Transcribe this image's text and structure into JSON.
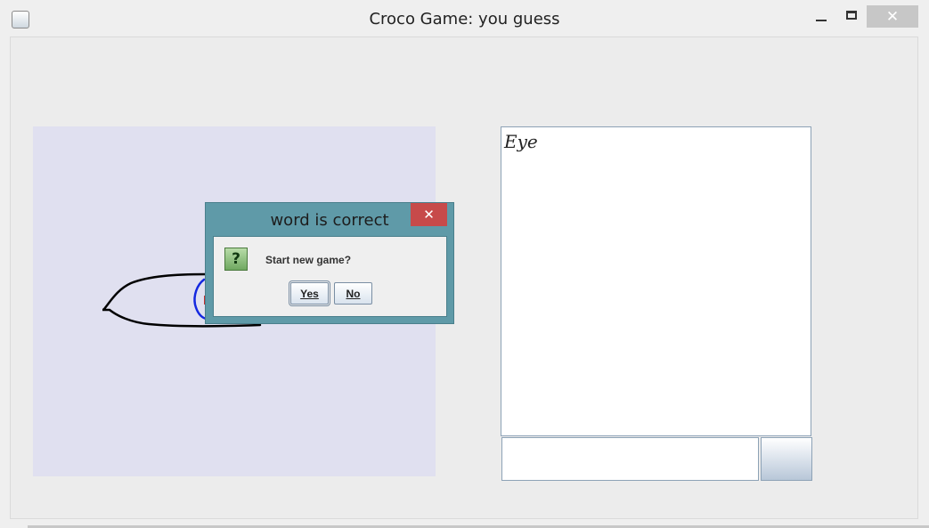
{
  "window": {
    "title": "Croco Game: you guess",
    "close_glyph": "✕"
  },
  "chat": {
    "messages": [
      "Eye"
    ]
  },
  "guess": {
    "value": "",
    "placeholder": ""
  },
  "dialog": {
    "title": "word is correct",
    "close_glyph": "✕",
    "icon_glyph": "?",
    "message": "Start new game?",
    "yes_label": "Yes",
    "no_label": "No"
  },
  "colors": {
    "canvas_bg": "#e0e0f0",
    "dialog_frame": "#5f9aa8",
    "close_red": "#c74a4a",
    "drawing_black": "#000000",
    "drawing_blue": "#1428e0"
  },
  "icons": {
    "app": "java-app-icon",
    "minimize": "minimize-icon",
    "maximize": "maximize-icon",
    "close": "close-icon",
    "question": "question-icon"
  }
}
